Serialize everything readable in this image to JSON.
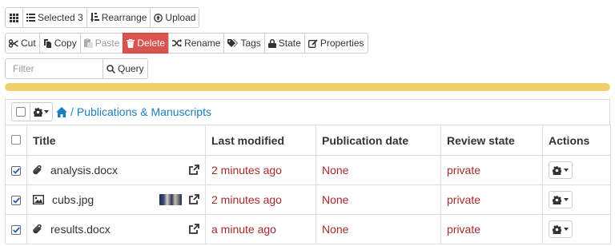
{
  "toolbar_top": {
    "selected_label": "Selected 3",
    "rearrange_label": "Rearrange",
    "upload_label": "Upload"
  },
  "toolbar_actions": {
    "cut_label": "Cut",
    "copy_label": "Copy",
    "paste_label": "Paste",
    "delete_label": "Delete",
    "rename_label": "Rename",
    "tags_label": "Tags",
    "state_label": "State",
    "properties_label": "Properties"
  },
  "search": {
    "placeholder": "Filter",
    "query_label": "Query"
  },
  "breadcrumb": {
    "separator": "/",
    "current": "Publications & Manuscripts"
  },
  "table": {
    "headers": [
      "Title",
      "Last modified",
      "Publication date",
      "Review state",
      "Actions"
    ],
    "rows": [
      {
        "title": "analysis.docx",
        "modified": "2 minutes ago",
        "pubdate": "None",
        "state": "private",
        "checked": true
      },
      {
        "title": "cubs.jpg",
        "modified": "2 minutes ago",
        "pubdate": "None",
        "state": "private",
        "checked": true
      },
      {
        "title": "results.docx",
        "modified": "a minute ago",
        "pubdate": "None",
        "state": "private",
        "checked": true
      }
    ]
  },
  "colors": {
    "delete_bg": "#d9534f",
    "progress": "#f0ce6b",
    "link": "#1a7fba",
    "value_red": "#a52a2a"
  }
}
